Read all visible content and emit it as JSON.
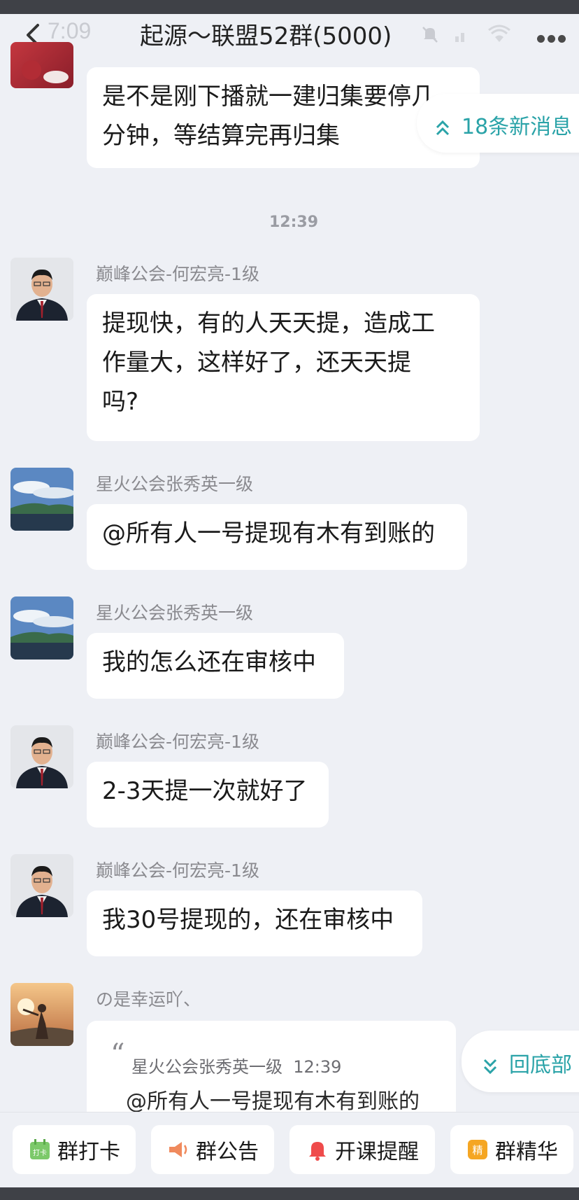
{
  "status": {
    "time": "7:09"
  },
  "header": {
    "title": "起源～联盟52群(5000)"
  },
  "new_messages_pill": "18条新消息",
  "back_to_bottom_pill": "回底部",
  "timestamp": "12:39",
  "messages": [
    {
      "sender": "",
      "lines": [
        "是不是刚下播就一建归集要停几",
        "分钟，等结算完再归集"
      ]
    },
    {
      "sender": "巅峰公会-何宏亮-1级",
      "lines": [
        "提现快，有的人天天提，造成工",
        "作量大，这样好了，还天天提",
        "吗?"
      ]
    },
    {
      "sender": "星火公会张秀英一级",
      "lines": [
        "@所有人一号提现有木有到账的"
      ]
    },
    {
      "sender": "星火公会张秀英一级",
      "lines": [
        "我的怎么还在审核中"
      ]
    },
    {
      "sender": "巅峰公会-何宏亮-1级",
      "lines": [
        "2-3天提一次就好了"
      ]
    },
    {
      "sender": "巅峰公会-何宏亮-1级",
      "lines": [
        "我30号提现的，还在审核中"
      ]
    },
    {
      "sender": "の是幸运吖、",
      "quote": {
        "author": "星火公会张秀英一级",
        "time": "12:39",
        "text": "@所有人一号提现有木有到账的"
      }
    }
  ],
  "toolbar": [
    {
      "label": "群打卡",
      "icon": "checkin-icon",
      "badge": "打卡"
    },
    {
      "label": "群公告",
      "icon": "announcement-icon"
    },
    {
      "label": "开课提醒",
      "icon": "bell-icon"
    },
    {
      "label": "群精华",
      "icon": "essence-icon",
      "badge": "精"
    }
  ],
  "colors": {
    "accent": "#2aa3a8",
    "background": "#eef0f5",
    "bubble": "#ffffff",
    "status_bar": "#3f4147"
  }
}
